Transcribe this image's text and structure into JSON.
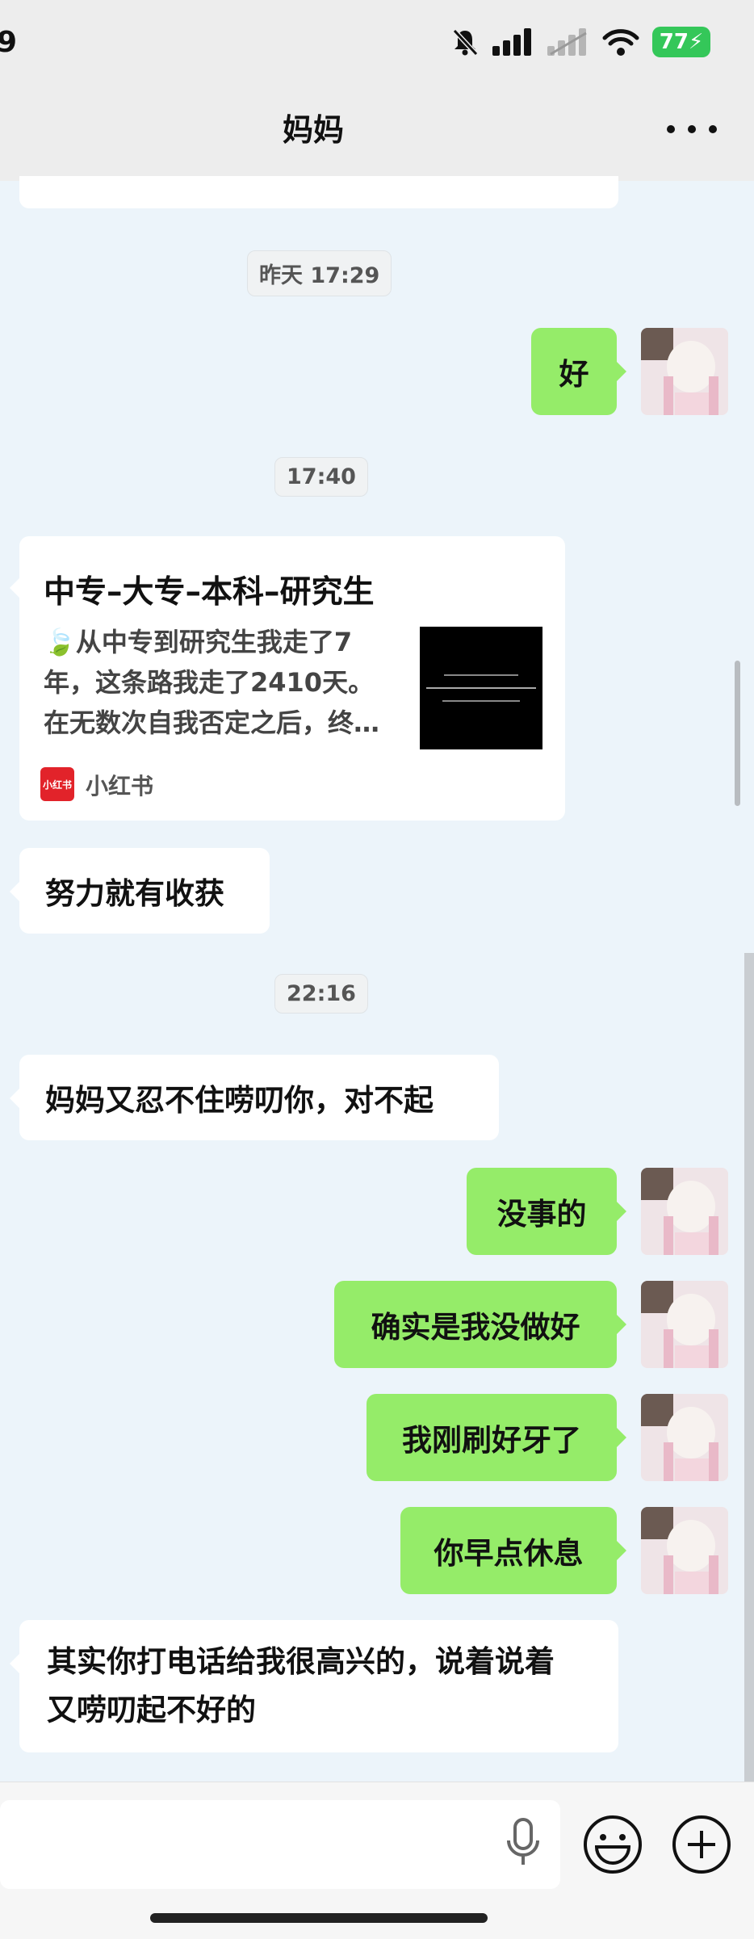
{
  "status_bar": {
    "time": "9",
    "battery": "77"
  },
  "header": {
    "title": "妈妈",
    "more_icon": "more-dots-icon"
  },
  "messages": [
    {
      "type": "timestamp",
      "text": "昨天 17:29"
    },
    {
      "type": "outgoing",
      "text": "好"
    },
    {
      "type": "timestamp",
      "text": "17:40"
    },
    {
      "type": "incoming_link_card",
      "title": "中专–大专–本科–研究生",
      "desc_line1": "🍃从中专到研究生我走了7",
      "desc_line2": "年，这条路我走了2410天。",
      "desc_line3": "在无数次自我否定之后，终…",
      "source": "小红书",
      "source_logo": "小红书"
    },
    {
      "type": "incoming",
      "text": "努力就有收获"
    },
    {
      "type": "timestamp",
      "text": "22:16"
    },
    {
      "type": "incoming",
      "text": "妈妈又忍不住唠叨你，对不起"
    },
    {
      "type": "outgoing",
      "text": "没事的"
    },
    {
      "type": "outgoing",
      "text": "确实是我没做好"
    },
    {
      "type": "outgoing",
      "text": "我刚刷好牙了"
    },
    {
      "type": "outgoing",
      "text": "你早点休息"
    },
    {
      "type": "incoming",
      "line1": "其实你打电话给我很高兴的，说着说着",
      "line2": "又唠叨起不好的"
    }
  ],
  "input_bar": {
    "mic_icon": "microphone-icon",
    "emoji_icon": "emoji-icon",
    "plus_icon": "plus-icon"
  },
  "colors": {
    "outgoing_bubble": "#95ec69",
    "incoming_bubble": "#ffffff",
    "background": "#ecf4fa"
  }
}
